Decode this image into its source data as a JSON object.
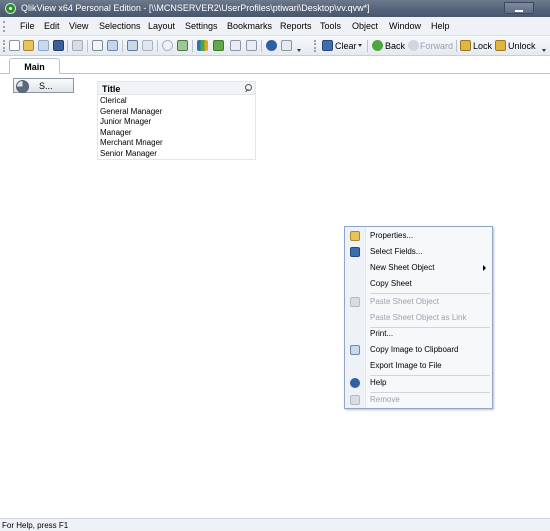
{
  "window": {
    "title": "QlikView x64 Personal Edition - [\\\\MCNSERVER2\\UserProfiles\\ptiwari\\Desktop\\vv.qvw*]"
  },
  "menubar": {
    "items": [
      "File",
      "Edit",
      "View",
      "Selections",
      "Layout",
      "Settings",
      "Bookmarks",
      "Reports",
      "Tools",
      "Object",
      "Window",
      "Help"
    ]
  },
  "toolbar": {
    "clear_label": "Clear",
    "back_label": "Back",
    "forward_label": "Forward",
    "lock_label": "Lock",
    "unlock_label": "Unlock",
    "icons": [
      "new-doc-icon",
      "open-folder-icon",
      "reload-icon",
      "save-icon",
      "print-icon",
      "edit-script-icon",
      "reload-data-icon",
      "undo-icon",
      "redo-icon",
      "search-icon",
      "select-fields-icon",
      "chart-wizard-icon",
      "bookmark-star-icon",
      "properties-icon",
      "help-icon",
      "context-help-icon"
    ]
  },
  "tabs": [
    {
      "label": "Main",
      "active": true
    }
  ],
  "minimized_object": {
    "label": "S..."
  },
  "listbox": {
    "title": "Title",
    "items": [
      "Clerical",
      "General Manager",
      "Junior Mnager",
      "Manager",
      "Merchant Mnager",
      "Senior Manager"
    ]
  },
  "context_menu": {
    "items": [
      {
        "label": "Properties...",
        "icon": "properties-icon",
        "enabled": true
      },
      {
        "label": "Select Fields...",
        "icon": "select-fields-icon",
        "enabled": true
      },
      {
        "label": "New Sheet Object",
        "icon": "",
        "enabled": true,
        "submenu": true
      },
      {
        "label": "Copy Sheet",
        "icon": "",
        "enabled": true
      },
      {
        "label": "Paste Sheet Object",
        "icon": "paste-icon",
        "enabled": false
      },
      {
        "label": "Paste Sheet Object as Link",
        "icon": "",
        "enabled": false
      },
      {
        "label": "Print...",
        "icon": "",
        "enabled": true
      },
      {
        "label": "Copy Image to Clipboard",
        "icon": "copy-image-icon",
        "enabled": true
      },
      {
        "label": "Export Image to File",
        "icon": "",
        "enabled": true
      },
      {
        "label": "Help",
        "icon": "help-icon",
        "enabled": true
      },
      {
        "label": "Remove",
        "icon": "remove-icon",
        "enabled": false
      }
    ]
  },
  "statusbar": {
    "text": "For Help, press F1"
  },
  "colors": {
    "accent": "#3a6ea5",
    "titlebar": "#55627a",
    "menu_border": "#8fa6c8",
    "disabled_text": "#9aa3ae"
  }
}
